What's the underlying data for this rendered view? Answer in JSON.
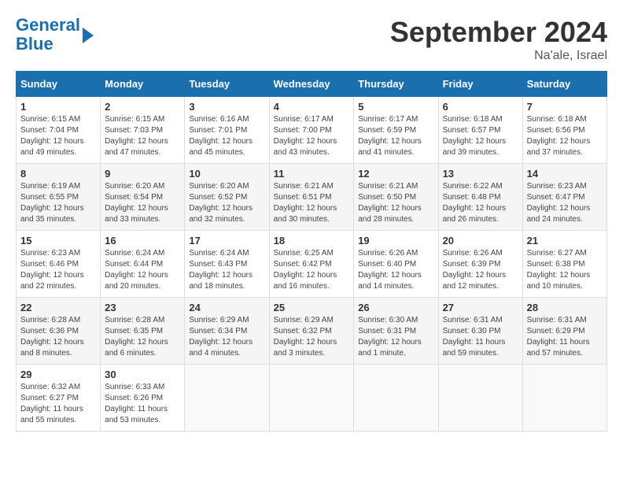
{
  "header": {
    "logo_line1": "General",
    "logo_line2": "Blue",
    "month_title": "September 2024",
    "location": "Na'ale, Israel"
  },
  "weekdays": [
    "Sunday",
    "Monday",
    "Tuesday",
    "Wednesday",
    "Thursday",
    "Friday",
    "Saturday"
  ],
  "weeks": [
    [
      {
        "day": "1",
        "info": "Sunrise: 6:15 AM\nSunset: 7:04 PM\nDaylight: 12 hours\nand 49 minutes."
      },
      {
        "day": "2",
        "info": "Sunrise: 6:15 AM\nSunset: 7:03 PM\nDaylight: 12 hours\nand 47 minutes."
      },
      {
        "day": "3",
        "info": "Sunrise: 6:16 AM\nSunset: 7:01 PM\nDaylight: 12 hours\nand 45 minutes."
      },
      {
        "day": "4",
        "info": "Sunrise: 6:17 AM\nSunset: 7:00 PM\nDaylight: 12 hours\nand 43 minutes."
      },
      {
        "day": "5",
        "info": "Sunrise: 6:17 AM\nSunset: 6:59 PM\nDaylight: 12 hours\nand 41 minutes."
      },
      {
        "day": "6",
        "info": "Sunrise: 6:18 AM\nSunset: 6:57 PM\nDaylight: 12 hours\nand 39 minutes."
      },
      {
        "day": "7",
        "info": "Sunrise: 6:18 AM\nSunset: 6:56 PM\nDaylight: 12 hours\nand 37 minutes."
      }
    ],
    [
      {
        "day": "8",
        "info": "Sunrise: 6:19 AM\nSunset: 6:55 PM\nDaylight: 12 hours\nand 35 minutes."
      },
      {
        "day": "9",
        "info": "Sunrise: 6:20 AM\nSunset: 6:54 PM\nDaylight: 12 hours\nand 33 minutes."
      },
      {
        "day": "10",
        "info": "Sunrise: 6:20 AM\nSunset: 6:52 PM\nDaylight: 12 hours\nand 32 minutes."
      },
      {
        "day": "11",
        "info": "Sunrise: 6:21 AM\nSunset: 6:51 PM\nDaylight: 12 hours\nand 30 minutes."
      },
      {
        "day": "12",
        "info": "Sunrise: 6:21 AM\nSunset: 6:50 PM\nDaylight: 12 hours\nand 28 minutes."
      },
      {
        "day": "13",
        "info": "Sunrise: 6:22 AM\nSunset: 6:48 PM\nDaylight: 12 hours\nand 26 minutes."
      },
      {
        "day": "14",
        "info": "Sunrise: 6:23 AM\nSunset: 6:47 PM\nDaylight: 12 hours\nand 24 minutes."
      }
    ],
    [
      {
        "day": "15",
        "info": "Sunrise: 6:23 AM\nSunset: 6:46 PM\nDaylight: 12 hours\nand 22 minutes."
      },
      {
        "day": "16",
        "info": "Sunrise: 6:24 AM\nSunset: 6:44 PM\nDaylight: 12 hours\nand 20 minutes."
      },
      {
        "day": "17",
        "info": "Sunrise: 6:24 AM\nSunset: 6:43 PM\nDaylight: 12 hours\nand 18 minutes."
      },
      {
        "day": "18",
        "info": "Sunrise: 6:25 AM\nSunset: 6:42 PM\nDaylight: 12 hours\nand 16 minutes."
      },
      {
        "day": "19",
        "info": "Sunrise: 6:26 AM\nSunset: 6:40 PM\nDaylight: 12 hours\nand 14 minutes."
      },
      {
        "day": "20",
        "info": "Sunrise: 6:26 AM\nSunset: 6:39 PM\nDaylight: 12 hours\nand 12 minutes."
      },
      {
        "day": "21",
        "info": "Sunrise: 6:27 AM\nSunset: 6:38 PM\nDaylight: 12 hours\nand 10 minutes."
      }
    ],
    [
      {
        "day": "22",
        "info": "Sunrise: 6:28 AM\nSunset: 6:36 PM\nDaylight: 12 hours\nand 8 minutes."
      },
      {
        "day": "23",
        "info": "Sunrise: 6:28 AM\nSunset: 6:35 PM\nDaylight: 12 hours\nand 6 minutes."
      },
      {
        "day": "24",
        "info": "Sunrise: 6:29 AM\nSunset: 6:34 PM\nDaylight: 12 hours\nand 4 minutes."
      },
      {
        "day": "25",
        "info": "Sunrise: 6:29 AM\nSunset: 6:32 PM\nDaylight: 12 hours\nand 3 minutes."
      },
      {
        "day": "26",
        "info": "Sunrise: 6:30 AM\nSunset: 6:31 PM\nDaylight: 12 hours\nand 1 minute."
      },
      {
        "day": "27",
        "info": "Sunrise: 6:31 AM\nSunset: 6:30 PM\nDaylight: 11 hours\nand 59 minutes."
      },
      {
        "day": "28",
        "info": "Sunrise: 6:31 AM\nSunset: 6:29 PM\nDaylight: 11 hours\nand 57 minutes."
      }
    ],
    [
      {
        "day": "29",
        "info": "Sunrise: 6:32 AM\nSunset: 6:27 PM\nDaylight: 11 hours\nand 55 minutes."
      },
      {
        "day": "30",
        "info": "Sunrise: 6:33 AM\nSunset: 6:26 PM\nDaylight: 11 hours\nand 53 minutes."
      },
      {
        "day": "",
        "info": ""
      },
      {
        "day": "",
        "info": ""
      },
      {
        "day": "",
        "info": ""
      },
      {
        "day": "",
        "info": ""
      },
      {
        "day": "",
        "info": ""
      }
    ]
  ]
}
